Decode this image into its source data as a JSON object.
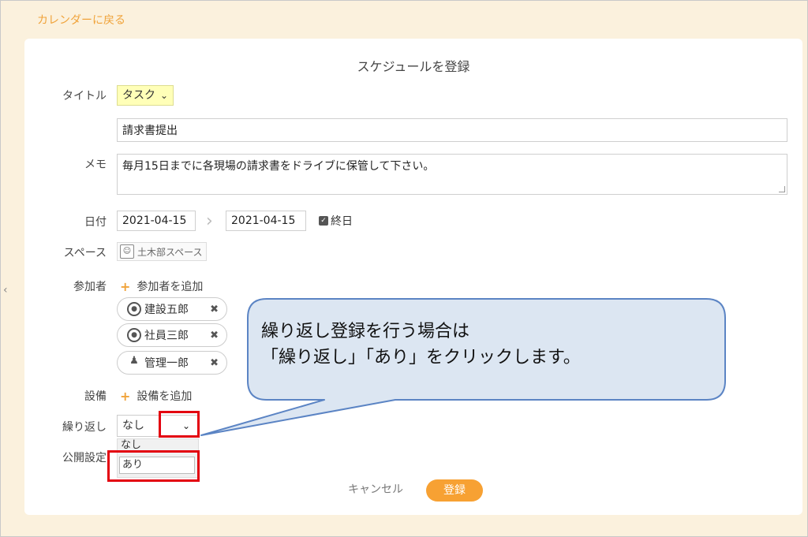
{
  "nav": {
    "back_label": "カレンダーに戻る",
    "side_arrow": "‹"
  },
  "form": {
    "title": "スケジュールを登録",
    "labels": {
      "title": "タイトル",
      "memo": "メモ",
      "date": "日付",
      "space": "スペース",
      "participants": "参加者",
      "equipment": "設備",
      "repeat": "繰り返し",
      "public": "公開設定"
    },
    "title_category": "タスク",
    "title_value": "請求書提出",
    "memo_value": "毎月15日までに各現場の請求書をドライブに保管して下さい。",
    "date_start": "2021-04-15",
    "date_end": "2021-04-15",
    "allday_label": "終日",
    "allday_checked": true,
    "space_name": "土木部スペース",
    "add_participant_label": "参加者を追加",
    "participants": [
      {
        "name": "建設五郎"
      },
      {
        "name": "社員三郎"
      },
      {
        "name": "管理一郎"
      }
    ],
    "add_equipment_label": "設備を追加",
    "repeat_value": "なし",
    "repeat_options": [
      "なし",
      "あり"
    ],
    "cancel_label": "キャンセル",
    "submit_label": "登録"
  },
  "callout": {
    "line1": "繰り返し登録を行う場合は",
    "line2": "「繰り返し」「あり」をクリックします。"
  },
  "colors": {
    "background": "#fbf1dd",
    "accent": "#f7a133",
    "highlight": "#e3000f",
    "callout_fill": "#dce6f2",
    "callout_stroke": "#5b84c4"
  }
}
